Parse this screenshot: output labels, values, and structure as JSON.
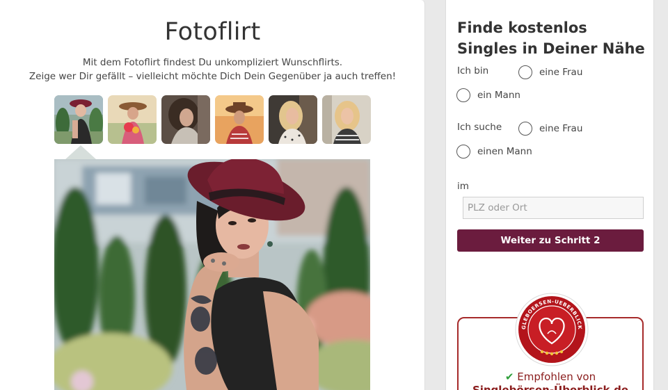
{
  "left": {
    "title": "Fotoflirt",
    "intro_line1": "Mit dem Fotoflirt findest Du unkompliziert Wunschflirts.",
    "intro_line2": "Zeige wer Dir gefällt – vielleicht möchte Dich Dein Gegenüber ja auch treffen!",
    "thumbnails": [
      {
        "name": "photo-1",
        "active": true
      },
      {
        "name": "photo-2",
        "active": false
      },
      {
        "name": "photo-3",
        "active": false
      },
      {
        "name": "photo-4",
        "active": false
      },
      {
        "name": "photo-5",
        "active": false
      },
      {
        "name": "photo-6",
        "active": false
      }
    ]
  },
  "form": {
    "heading": "Finde kostenlos Singles in Deiner Nähe",
    "ich_bin_label": "Ich bin",
    "bin_option_frau": "eine Frau",
    "bin_option_mann": "ein Mann",
    "ich_suche_label": "Ich suche",
    "suche_option_frau": "eine Frau",
    "suche_option_mann": "einen Mann",
    "im_label": "im",
    "location_placeholder": "PLZ oder Ort",
    "next_button": "Weiter zu Schritt 2"
  },
  "recommendation": {
    "check_icon": "checkmark-icon",
    "line1": "Empfohlen von",
    "line2": "Singlebörsen-Überblick.de",
    "seal_text": "SINGLEBOERSEN-UEBERBLICK.DE",
    "colors": {
      "seal_red": "#b3141b",
      "accent": "#6b1c3e",
      "check": "#2e9e3a"
    }
  }
}
